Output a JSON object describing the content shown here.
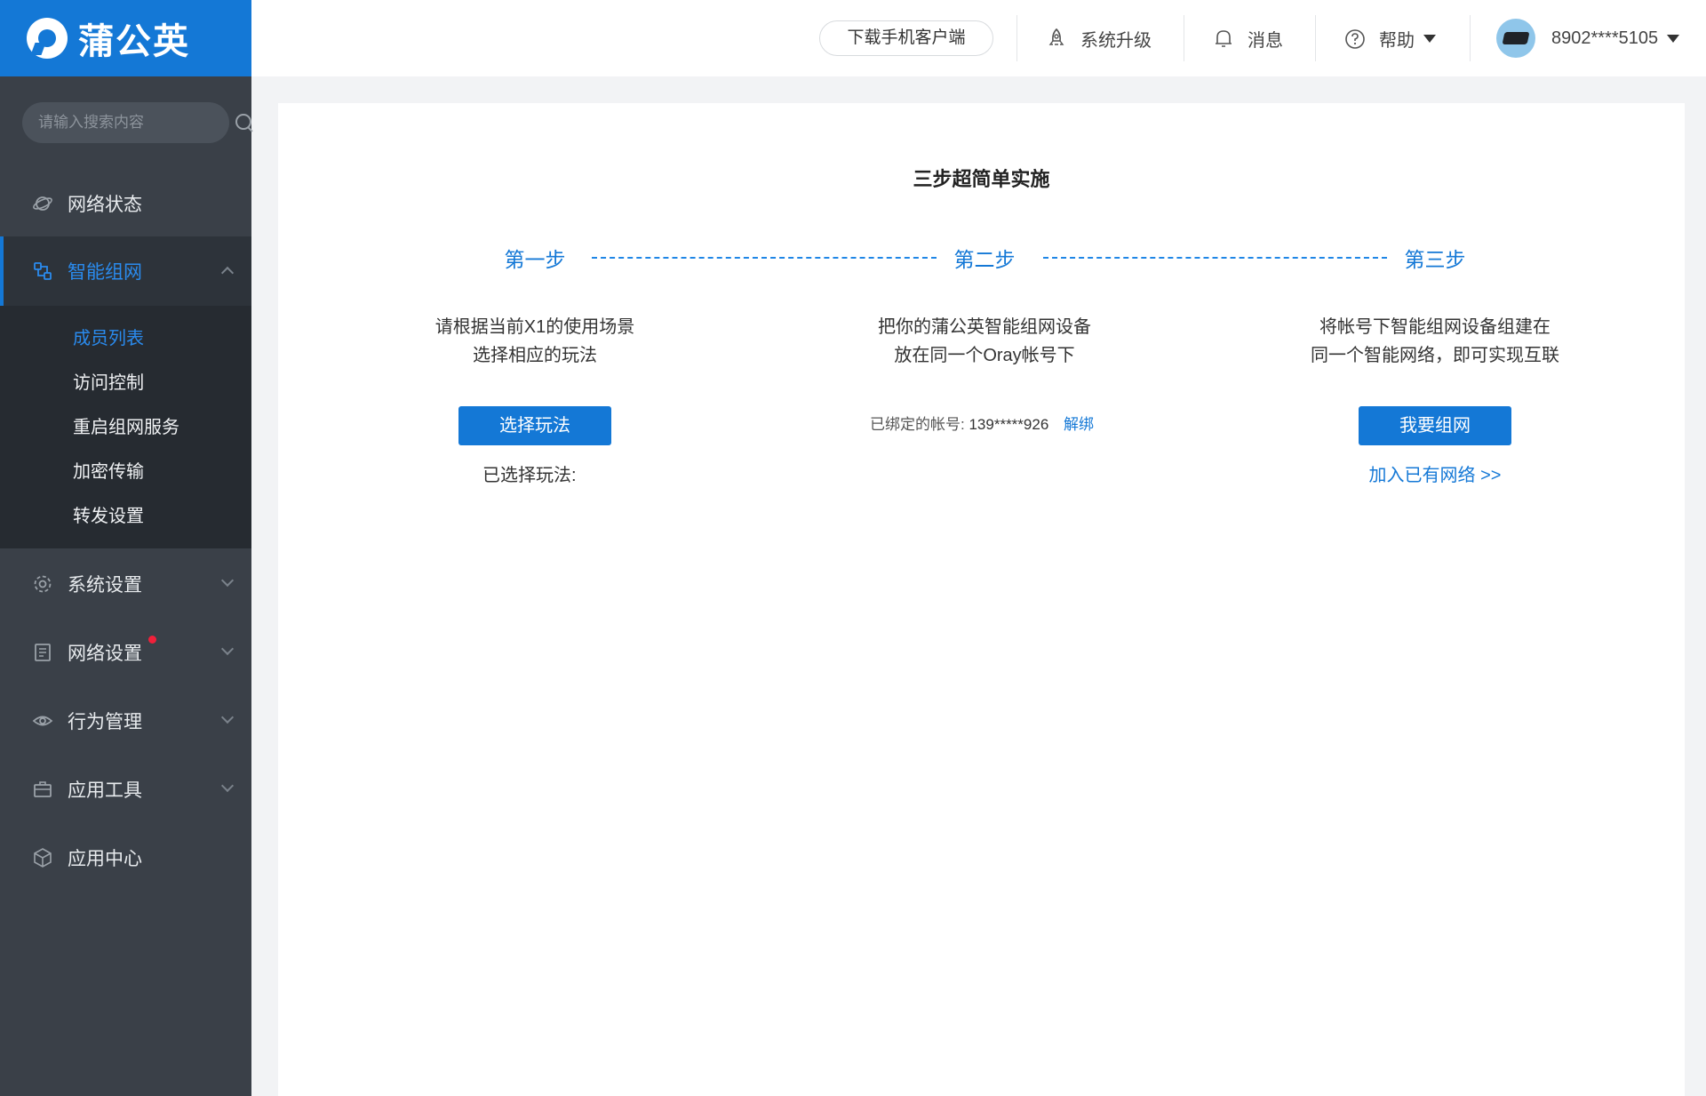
{
  "brand": {
    "name": "蒲公英"
  },
  "search": {
    "placeholder": "请输入搜索内容"
  },
  "sidebar": {
    "items": [
      {
        "label": "网络状态",
        "icon": "planet-icon"
      },
      {
        "label": "智能组网",
        "icon": "network-icon",
        "active": true,
        "expanded": true
      },
      {
        "label": "系统设置",
        "icon": "gear-icon"
      },
      {
        "label": "网络设置",
        "icon": "document-icon",
        "badge_dot": true
      },
      {
        "label": "行为管理",
        "icon": "eye-icon"
      },
      {
        "label": "应用工具",
        "icon": "briefcase-icon"
      },
      {
        "label": "应用中心",
        "icon": "cube-icon"
      }
    ],
    "submenu": [
      "成员列表",
      "访问控制",
      "重启组网服务",
      "加密传输",
      "转发设置"
    ],
    "active_submenu": "成员列表"
  },
  "header": {
    "download": "下载手机客户端",
    "upgrade": "系统升级",
    "messages": "消息",
    "help": "帮助",
    "account": "8902****5105"
  },
  "main": {
    "title": "三步超简单实施",
    "steps": [
      {
        "label": "第一步",
        "desc1": "请根据当前X1的使用场景",
        "desc2": "选择相应的玩法",
        "button": "选择玩法",
        "note": "已选择玩法:"
      },
      {
        "label": "第二步",
        "desc1": "把你的蒲公英智能组网设备",
        "desc2": "放在同一个Oray帐号下",
        "bound_label": "已绑定的帐号:",
        "bound_account": "139*****926",
        "unbind": "解绑"
      },
      {
        "label": "第三步",
        "desc1": "将帐号下智能组网设备组建在",
        "desc2": "同一个智能网络，即可实现互联",
        "button": "我要组网",
        "link": "加入已有网络 >>"
      }
    ]
  },
  "colors": {
    "brand": "#1478d6",
    "sidebar_bg": "#3a4048",
    "submenu_bg": "#262b31",
    "badge": "#f0203a"
  }
}
